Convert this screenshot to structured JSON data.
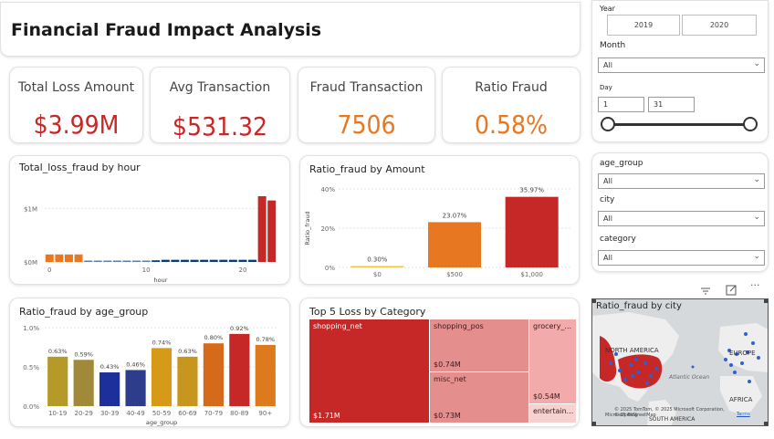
{
  "title": "Financial Fraud Impact Analysis",
  "kpis": [
    {
      "label": "Total Loss Amount",
      "value": "$3.99M",
      "color": "#c62828"
    },
    {
      "label": "Avg Transaction",
      "value": "$531.32",
      "color": "#c62828"
    },
    {
      "label": "Fraud Transaction",
      "value": "7506",
      "color": "#e87722"
    },
    {
      "label": "Ratio Fraud",
      "value": "0.58%",
      "color": "#e87722"
    }
  ],
  "filters": {
    "year_label": "Year",
    "years": [
      "2019",
      "2020"
    ],
    "month_label": "Month",
    "month_value": "All",
    "day_label": "Day",
    "day_from": "1",
    "day_to": "31",
    "age_group_label": "age_group",
    "age_group_value": "All",
    "city_label": "city",
    "city_value": "All",
    "category_label": "category",
    "category_value": "All"
  },
  "map": {
    "title": "Ratio_fraud by city",
    "labels": [
      "NORTH AMERICA",
      "EUROPE",
      "Atlantic Ocean",
      "AFRICA",
      "SOUTH AMERICA"
    ],
    "copyright": "© 2025 TomTom, © 2025 Microsoft Corporation, © OpenStreetMap",
    "terms": "Terms",
    "brand": "Microsoft Bing"
  },
  "treemap": {
    "title": "Top 5 Loss by Category",
    "items": [
      {
        "name": "shopping_net",
        "value": "$1.71M"
      },
      {
        "name": "shopping_pos",
        "value": "$0.74M"
      },
      {
        "name": "misc_net",
        "value": "$0.73M"
      },
      {
        "name": "grocery_...",
        "value": "$0.54M"
      },
      {
        "name": "entertain...",
        "value": ""
      }
    ]
  },
  "chart_data": [
    {
      "type": "bar",
      "title": "Total_loss_fraud by hour",
      "xlabel": "hour",
      "ylabel": "",
      "x_ticks": [
        "0",
        "10",
        "20"
      ],
      "y_ticks": [
        "$0M",
        "$1M"
      ],
      "ylim": [
        0,
        1.4
      ],
      "categories": [
        "0",
        "1",
        "2",
        "3",
        "4",
        "5",
        "6",
        "7",
        "8",
        "9",
        "10",
        "11",
        "12",
        "13",
        "14",
        "15",
        "16",
        "17",
        "18",
        "19",
        "20",
        "21",
        "22",
        "23"
      ],
      "values": [
        0.14,
        0.14,
        0.14,
        0.14,
        0.02,
        0.02,
        0.02,
        0.02,
        0.02,
        0.02,
        0.02,
        0.03,
        0.04,
        0.04,
        0.04,
        0.04,
        0.04,
        0.04,
        0.04,
        0.04,
        0.04,
        0.04,
        1.23,
        1.15
      ],
      "colors": [
        "#e87722",
        "#e87722",
        "#e87722",
        "#e87722",
        "#5b7fa6",
        "#5b7fa6",
        "#5b7fa6",
        "#5b7fa6",
        "#5b7fa6",
        "#5b7fa6",
        "#5b7fa6",
        "#0d3b73",
        "#0d3b73",
        "#0d3b73",
        "#0d3b73",
        "#0d3b73",
        "#0d3b73",
        "#0d3b73",
        "#0d3b73",
        "#0d3b73",
        "#0d3b73",
        "#0d3b73",
        "#c62828",
        "#c62828"
      ]
    },
    {
      "type": "bar",
      "title": "Ratio_fraud by Amount",
      "xlabel": "",
      "ylabel": "Ratio_fraud",
      "y_ticks": [
        "0%",
        "20%",
        "40%"
      ],
      "ylim": [
        0,
        40
      ],
      "categories": [
        "$0",
        "$500",
        "$1,000"
      ],
      "values": [
        0.3,
        23.07,
        35.97
      ],
      "labels": [
        "0.30%",
        "23.07%",
        "35.97%"
      ],
      "colors": [
        "#f2c744",
        "#e87722",
        "#c62828"
      ]
    },
    {
      "type": "bar",
      "title": "Ratio_fraud by age_group",
      "xlabel": "age_group",
      "ylabel": "",
      "y_ticks": [
        "0.0%",
        "0.5%",
        "1.0%"
      ],
      "ylim": [
        0,
        1.0
      ],
      "categories": [
        "10-19",
        "20-29",
        "30-39",
        "40-49",
        "50-59",
        "60-69",
        "70-79",
        "80-89",
        "90+"
      ],
      "values": [
        0.63,
        0.59,
        0.43,
        0.46,
        0.74,
        0.63,
        0.8,
        0.92,
        0.78
      ],
      "labels": [
        "0.63%",
        "0.59%",
        "0.43%",
        "0.46%",
        "0.74%",
        "0.63%",
        "0.80%",
        "0.92%",
        "0.78%"
      ],
      "colors": [
        "#b59a2a",
        "#a08a3a",
        "#1d2f9a",
        "#2d3d8c",
        "#d49a18",
        "#c8961e",
        "#d56a1a",
        "#c62828",
        "#dd7a1e"
      ]
    }
  ]
}
